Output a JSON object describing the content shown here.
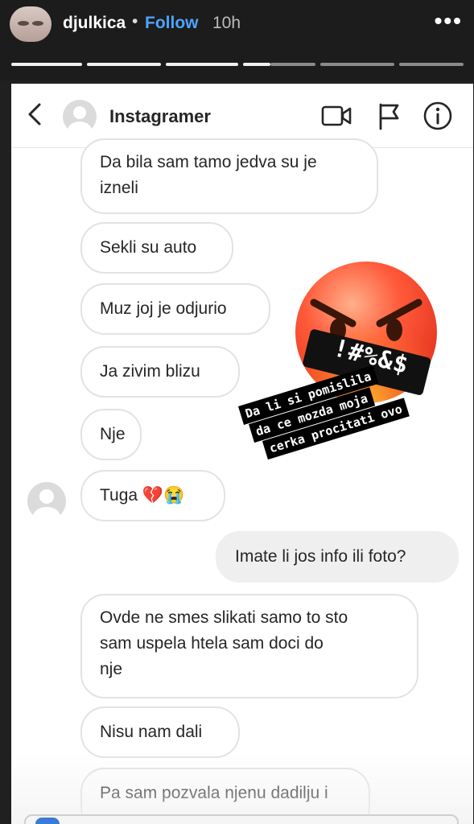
{
  "story": {
    "username": "djulkica",
    "separator": "•",
    "follow_label": "Follow",
    "time": "10h",
    "more_label": "•••"
  },
  "dm": {
    "contact_name": "Instagramer",
    "icons": [
      "back-chevron-icon",
      "video-camera-icon",
      "flag-icon",
      "info-icon"
    ]
  },
  "messages": [
    {
      "text": "Da bila sam tamo jedva su je\nizneli",
      "mine": false
    },
    {
      "text": "Sekli su auto",
      "mine": false
    },
    {
      "text": "Muz joj je odjurio",
      "mine": false
    },
    {
      "text": "Ja zivim blizu",
      "mine": false
    },
    {
      "text": "Nje",
      "mine": false
    },
    {
      "text": "Tuga 💔😭",
      "mine": false
    },
    {
      "text": "Imate li jos info ili foto?",
      "mine": true
    },
    {
      "text": "Ovde ne smes slikati samo to sto\nsam uspela htela  sam doci do\nnje",
      "mine": false
    },
    {
      "text": "Nisu nam dali",
      "mine": false
    },
    {
      "text": "Pa sam pozvala njenu dadilju i",
      "mine": false
    }
  ],
  "sticker": {
    "symbols": "!#%&$",
    "icon": "angry-face-symbols-icon"
  },
  "caption": {
    "line1": "Da li si pomislila",
    "line2": "da ce mozda moja",
    "line3": "cerka procitati ovo"
  },
  "colors": {
    "follow": "#4ea4ff",
    "my_bubble": "#efefef",
    "sticker_red": "#e8412c"
  }
}
